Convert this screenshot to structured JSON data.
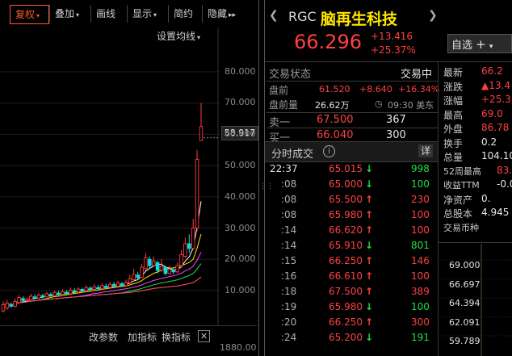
{
  "toolbar": {
    "buttons": [
      {
        "label": "复权",
        "active": true,
        "dropdown": true
      },
      {
        "label": "叠加",
        "active": false,
        "dropdown": true
      },
      {
        "label": "画线",
        "active": false,
        "dropdown": false
      },
      {
        "label": "显示",
        "active": false,
        "dropdown": true
      },
      {
        "label": "简约",
        "active": false,
        "dropdown": false
      },
      {
        "label": "隐藏",
        "active": false,
        "dropdown": false
      }
    ],
    "more_icon": "double-chevron-right-icon"
  },
  "chart_settings_label": "设置均线",
  "price_marker": "58.917",
  "chart_bottom_buttons": {
    "change_params": "改参数",
    "add_indicator": "加指标",
    "switch_indicator": "换指标"
  },
  "volume_tick": "1880.00",
  "chart_data": {
    "type": "candlestick",
    "yticks": [
      "80.000",
      "70.000",
      "60.000",
      "50.000",
      "40.000",
      "30.000",
      "20.000",
      "10.000"
    ],
    "ylim": [
      5,
      90
    ],
    "candles": [
      {
        "o": 3.5,
        "c": 5.5,
        "h": 6.5,
        "l": 3.0
      },
      {
        "o": 4.5,
        "c": 6.0,
        "h": 7.0,
        "l": 3.8
      },
      {
        "o": 5.5,
        "c": 5.0,
        "h": 6.2,
        "l": 4.5
      },
      {
        "o": 5.0,
        "c": 6.5,
        "h": 7.5,
        "l": 4.6
      },
      {
        "o": 6.2,
        "c": 7.8,
        "h": 8.5,
        "l": 5.8
      },
      {
        "o": 7.5,
        "c": 6.8,
        "h": 8.2,
        "l": 6.0
      },
      {
        "o": 6.8,
        "c": 7.2,
        "h": 8.0,
        "l": 6.2
      },
      {
        "o": 7.0,
        "c": 8.2,
        "h": 9.0,
        "l": 6.6
      },
      {
        "o": 8.0,
        "c": 7.6,
        "h": 8.8,
        "l": 7.0
      },
      {
        "o": 7.6,
        "c": 8.6,
        "h": 9.2,
        "l": 7.2
      },
      {
        "o": 8.4,
        "c": 8.0,
        "h": 9.0,
        "l": 7.5
      },
      {
        "o": 8.0,
        "c": 9.0,
        "h": 9.6,
        "l": 7.8
      },
      {
        "o": 8.8,
        "c": 8.4,
        "h": 9.4,
        "l": 8.0
      },
      {
        "o": 8.4,
        "c": 9.4,
        "h": 10.0,
        "l": 8.2
      },
      {
        "o": 9.2,
        "c": 8.8,
        "h": 10.0,
        "l": 8.4
      },
      {
        "o": 8.8,
        "c": 9.6,
        "h": 10.4,
        "l": 8.5
      },
      {
        "o": 9.5,
        "c": 9.0,
        "h": 10.2,
        "l": 8.7
      },
      {
        "o": 9.0,
        "c": 10.2,
        "h": 11.0,
        "l": 8.8
      },
      {
        "o": 10.0,
        "c": 9.6,
        "h": 10.8,
        "l": 9.2
      },
      {
        "o": 9.6,
        "c": 10.5,
        "h": 11.2,
        "l": 9.3
      },
      {
        "o": 10.4,
        "c": 10.0,
        "h": 11.0,
        "l": 9.6
      },
      {
        "o": 10.0,
        "c": 11.0,
        "h": 11.8,
        "l": 9.8
      },
      {
        "o": 10.8,
        "c": 10.4,
        "h": 11.4,
        "l": 10.0
      },
      {
        "o": 10.4,
        "c": 11.2,
        "h": 12.0,
        "l": 10.1
      },
      {
        "o": 11.0,
        "c": 10.6,
        "h": 11.8,
        "l": 10.2
      },
      {
        "o": 10.6,
        "c": 11.6,
        "h": 12.4,
        "l": 10.4
      },
      {
        "o": 11.4,
        "c": 11.0,
        "h": 12.2,
        "l": 10.6
      },
      {
        "o": 11.0,
        "c": 12.0,
        "h": 12.8,
        "l": 10.8
      },
      {
        "o": 12.0,
        "c": 11.4,
        "h": 12.8,
        "l": 11.0
      },
      {
        "o": 11.4,
        "c": 12.4,
        "h": 13.2,
        "l": 11.1
      },
      {
        "o": 12.2,
        "c": 11.6,
        "h": 12.8,
        "l": 11.2
      },
      {
        "o": 11.6,
        "c": 12.6,
        "h": 13.5,
        "l": 11.3
      },
      {
        "o": 12.5,
        "c": 13.8,
        "h": 15.0,
        "l": 12.2
      },
      {
        "o": 13.5,
        "c": 15.2,
        "h": 17.0,
        "l": 13.0
      },
      {
        "o": 15.0,
        "c": 14.2,
        "h": 16.0,
        "l": 13.5
      },
      {
        "o": 14.2,
        "c": 17.5,
        "h": 18.5,
        "l": 14.0
      },
      {
        "o": 17.0,
        "c": 20.5,
        "h": 22.0,
        "l": 16.5
      },
      {
        "o": 20.0,
        "c": 18.0,
        "h": 21.0,
        "l": 17.0
      },
      {
        "o": 18.0,
        "c": 19.5,
        "h": 21.0,
        "l": 17.5
      },
      {
        "o": 19.0,
        "c": 16.5,
        "h": 19.5,
        "l": 15.5
      },
      {
        "o": 16.5,
        "c": 17.8,
        "h": 20.0,
        "l": 16.0
      },
      {
        "o": 17.5,
        "c": 15.5,
        "h": 18.0,
        "l": 14.8
      },
      {
        "o": 15.5,
        "c": 16.8,
        "h": 18.0,
        "l": 15.0
      },
      {
        "o": 16.5,
        "c": 16.0,
        "h": 17.5,
        "l": 15.2
      },
      {
        "o": 16.0,
        "c": 18.0,
        "h": 19.0,
        "l": 15.5
      },
      {
        "o": 18.0,
        "c": 21.5,
        "h": 23.0,
        "l": 17.5
      },
      {
        "o": 21.0,
        "c": 25.0,
        "h": 27.0,
        "l": 20.5
      },
      {
        "o": 25.0,
        "c": 23.5,
        "h": 28.0,
        "l": 22.0
      },
      {
        "o": 23.5,
        "c": 30.0,
        "h": 33.0,
        "l": 23.0
      },
      {
        "o": 30.0,
        "c": 52.0,
        "h": 55.0,
        "l": 29.0
      },
      {
        "o": 58.0,
        "c": 62.5,
        "h": 70.0,
        "l": 58.0
      }
    ],
    "ma_colors": [
      "#ffffff",
      "#ffe600",
      "#ff40ff",
      "#22dd44",
      "#3a9cff",
      "#ff4040"
    ]
  },
  "quote": {
    "ticker": "RGC",
    "name": "脑再生科技",
    "price": "66.296",
    "change": "+13.416",
    "change_pct": "+25.37%",
    "watch_button": "自选",
    "status_label": "交易状态",
    "status_value": "交易中",
    "premarket_label": "盘前",
    "premarket_price": "61.520",
    "premarket_change": "+8.640",
    "premarket_pct": "+16.34%",
    "premarket_vol_label": "盘前量",
    "premarket_vol": "26.62万",
    "time": "09:30 美东",
    "ask_label": "卖一",
    "ask_price": "67.500",
    "ask_vol": "367",
    "bid_label": "买一",
    "bid_price": "66.040",
    "bid_vol": "300"
  },
  "trades_header": {
    "title": "分时成交",
    "detail": "详"
  },
  "trades": [
    {
      "time": "22:37",
      "price": "65.015",
      "dir": "down",
      "vol": "998"
    },
    {
      "time": ":08",
      "price": "65.000",
      "dir": "down",
      "vol": "100"
    },
    {
      "time": ":08",
      "price": "65.500",
      "dir": "up",
      "vol": "230"
    },
    {
      "time": ":08",
      "price": "65.980",
      "dir": "up",
      "vol": "100"
    },
    {
      "time": ":14",
      "price": "66.620",
      "dir": "up",
      "vol": "100"
    },
    {
      "time": ":14",
      "price": "65.910",
      "dir": "down",
      "vol": "801"
    },
    {
      "time": ":15",
      "price": "66.250",
      "dir": "up",
      "vol": "146"
    },
    {
      "time": ":16",
      "price": "66.610",
      "dir": "up",
      "vol": "100"
    },
    {
      "time": ":18",
      "price": "67.500",
      "dir": "up",
      "vol": "389"
    },
    {
      "time": ":19",
      "price": "65.980",
      "dir": "down",
      "vol": "100"
    },
    {
      "time": ":20",
      "price": "66.250",
      "dir": "up",
      "vol": "300"
    },
    {
      "time": ":24",
      "price": "65.200",
      "dir": "down",
      "vol": "191"
    }
  ],
  "stats": [
    {
      "label": "最新",
      "value": "66.2",
      "color": "red"
    },
    {
      "label": "涨跌",
      "value": "▲13.4",
      "color": "red"
    },
    {
      "label": "涨幅",
      "value": "+25.3",
      "color": "red"
    },
    {
      "label": "最高",
      "value": "69.0",
      "color": "red"
    },
    {
      "label": "外盘",
      "value": "86.78",
      "color": "red"
    },
    {
      "label": "换手",
      "value": "0.2",
      "color": "white"
    },
    {
      "label": "总量",
      "value": "104.10",
      "color": "white"
    },
    {
      "label": "52周最高",
      "value": "83.",
      "color": "red"
    },
    {
      "label": "收益TTM",
      "value": "-0.0",
      "color": "white"
    },
    {
      "label": "净资产",
      "value": "0.",
      "color": "white"
    },
    {
      "label": "总股本",
      "value": "4.945",
      "color": "white"
    },
    {
      "label": "交易币种",
      "value": "",
      "color": "white"
    }
  ],
  "mini_chart": {
    "ticks": [
      "69.000",
      "66.697",
      "64.394",
      "62.091",
      "59.789"
    ]
  }
}
